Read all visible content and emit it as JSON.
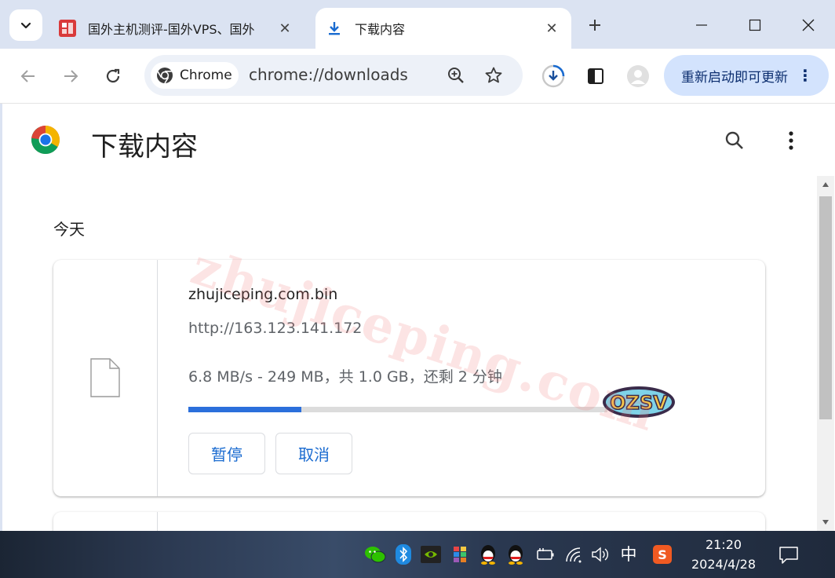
{
  "tabs": [
    {
      "title": "国外主机测评-国外VPS、国外",
      "active": false
    },
    {
      "title": "下载内容",
      "active": true
    }
  ],
  "omnibox": {
    "chip_label": "Chrome",
    "url": "chrome://downloads"
  },
  "update_button": {
    "label": "重新启动即可更新"
  },
  "page": {
    "title": "下载内容",
    "section": "今天"
  },
  "download": {
    "file_name": "zhujiceping.com.bin",
    "source_url": "http://163.123.141.172",
    "status": "6.8 MB/s - 249 MB，共 1.0 GB，还剩 2 分钟",
    "progress": 0.27,
    "pause_label": "暂停",
    "cancel_label": "取消"
  },
  "watermark": "zhujiceping.com",
  "badge_text": "OZSV",
  "taskbar": {
    "ime": "中",
    "time": "21:20",
    "date": "2024/4/28"
  },
  "colors": {
    "accent": "#1a6bd0",
    "progress_fill": "#2b6fdb",
    "update_bg": "#d3e3fd",
    "tab_strip": "#dbe3f2"
  }
}
